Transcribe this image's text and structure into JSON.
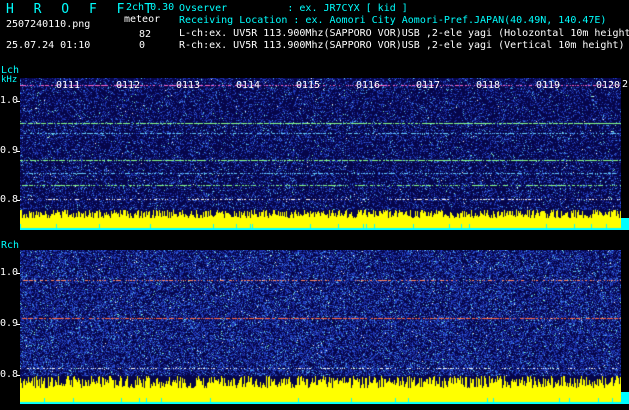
{
  "header": {
    "app_title": "H R O F F T",
    "version": "2ch 0.30",
    "meteor_label": "meteor",
    "file_name": "2507240110.png",
    "datetime": "25.07.24 01:10",
    "lch_count": "82",
    "rch_count": "0",
    "observer": "Ovserver          : ex. JR7CYX [ kid ]",
    "location": "Receiving Location : ex. Aomori City Aomori-Pref.JAPAN(40.49N, 140.47E)",
    "lch_info": "L-ch:ex. UV5R 113.900Mhz(SAPPORO VOR)USB ,2-ele yagi (Holozontal 10m height)",
    "rch_info": "R-ch:ex. UV5R 113.900Mhz(SAPPORO VOR)USB ,2-ele yagi (Vertical 10m height)"
  },
  "left_channel": {
    "label": "Lch",
    "unit": "kHz",
    "y_ticks": [
      "1.0",
      "0.9",
      "0.8"
    ],
    "time_labels": [
      "0111",
      "0112",
      "0113",
      "0114",
      "0115",
      "0116",
      "0117",
      "0118",
      "0119",
      "0120"
    ],
    "trailing_label": "2"
  },
  "right_channel": {
    "label": "Rch",
    "y_ticks": [
      "1.0",
      "0.9",
      "0.8"
    ]
  },
  "colors": {
    "background": "#000000",
    "label_cyan": "#00ffff",
    "noise_yellow": "#ffff00",
    "spectrum_dark": "#0a0a55"
  }
}
